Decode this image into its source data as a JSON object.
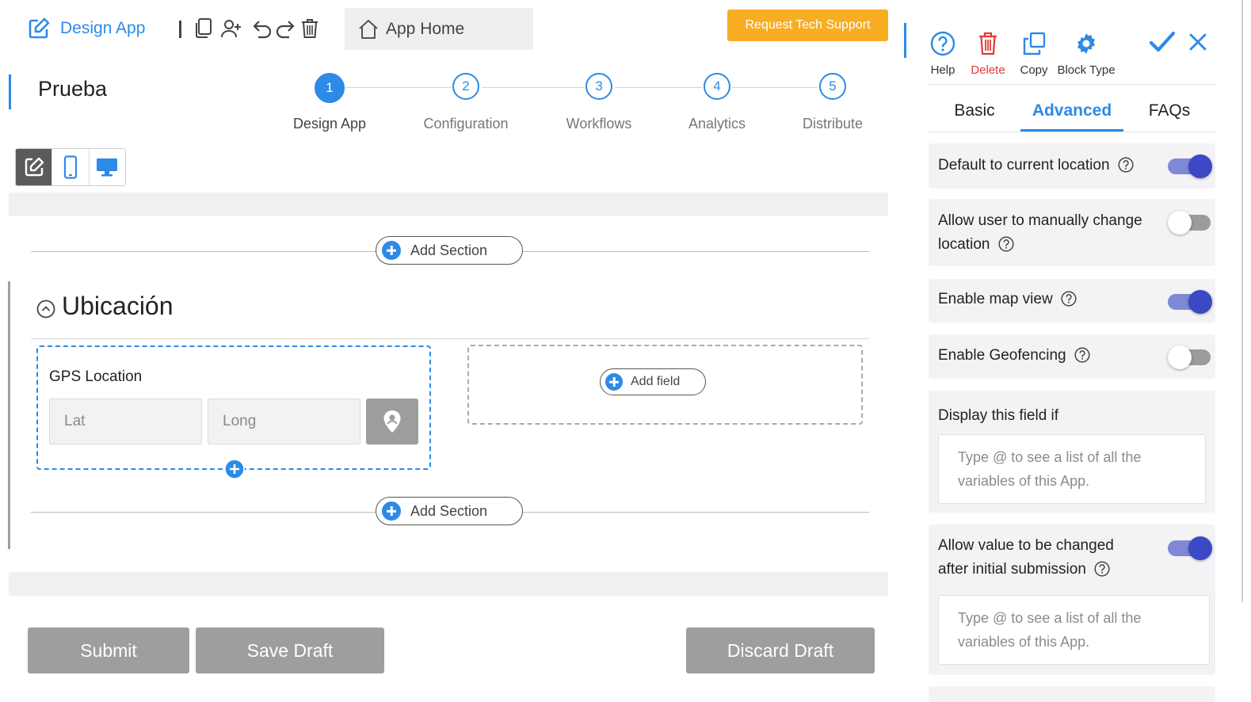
{
  "toolbar": {
    "design_app_label": "Design App",
    "icons": [
      "edit-icon",
      "duplicate-icon",
      "add-user-icon",
      "undo-icon",
      "redo-icon",
      "trash-icon"
    ],
    "app_home_label": "App Home",
    "tech_support_label": "Request Tech Support"
  },
  "app_title": "Prueba",
  "stepper": {
    "steps": [
      {
        "number": "1",
        "label": "Design App",
        "active": true
      },
      {
        "number": "2",
        "label": "Configuration",
        "active": false
      },
      {
        "number": "3",
        "label": "Workflows",
        "active": false
      },
      {
        "number": "4",
        "label": "Analytics",
        "active": false
      },
      {
        "number": "5",
        "label": "Distribute",
        "active": false
      }
    ]
  },
  "view_toggle": {
    "active": "edit"
  },
  "canvas": {
    "add_section_label": "Add Section",
    "section_title": "Ubicación",
    "gps_block": {
      "label": "GPS Location",
      "lat_placeholder": "Lat",
      "long_placeholder": "Long"
    },
    "add_field_label": "Add field"
  },
  "footer": {
    "submit_label": "Submit",
    "save_draft_label": "Save Draft",
    "discard_draft_label": "Discard Draft"
  },
  "right_panel": {
    "tools": {
      "help_label": "Help",
      "delete_label": "Delete",
      "copy_label": "Copy",
      "block_type_label": "Block Type"
    },
    "tabs": {
      "basic": "Basic",
      "advanced": "Advanced",
      "faqs": "FAQs",
      "active": "Advanced"
    },
    "settings": {
      "default_location": {
        "label": "Default to current location",
        "enabled": true
      },
      "allow_change_location": {
        "label_line1": "Allow user to manually change",
        "label_line2": "location",
        "enabled": false
      },
      "map_view": {
        "label": "Enable map view",
        "enabled": true
      },
      "geofencing": {
        "label": "Enable Geofencing",
        "enabled": false
      },
      "display_if": {
        "label": "Display this field if",
        "placeholder_line1": "Type @ to see a list of all the",
        "placeholder_line2": "variables of this App."
      },
      "allow_value_change": {
        "label_line1": "Allow value to be changed",
        "label_line2": "after initial submission",
        "enabled": true,
        "placeholder_line1": "Type @ to see a list of all the",
        "placeholder_line2": "variables of this App."
      }
    }
  },
  "colors": {
    "accent": "#2d8ae6",
    "support_button": "#f8ad22",
    "toggle_on": "#3b49c4",
    "delete": "#e53935",
    "grey_button": "#9e9e9e"
  }
}
